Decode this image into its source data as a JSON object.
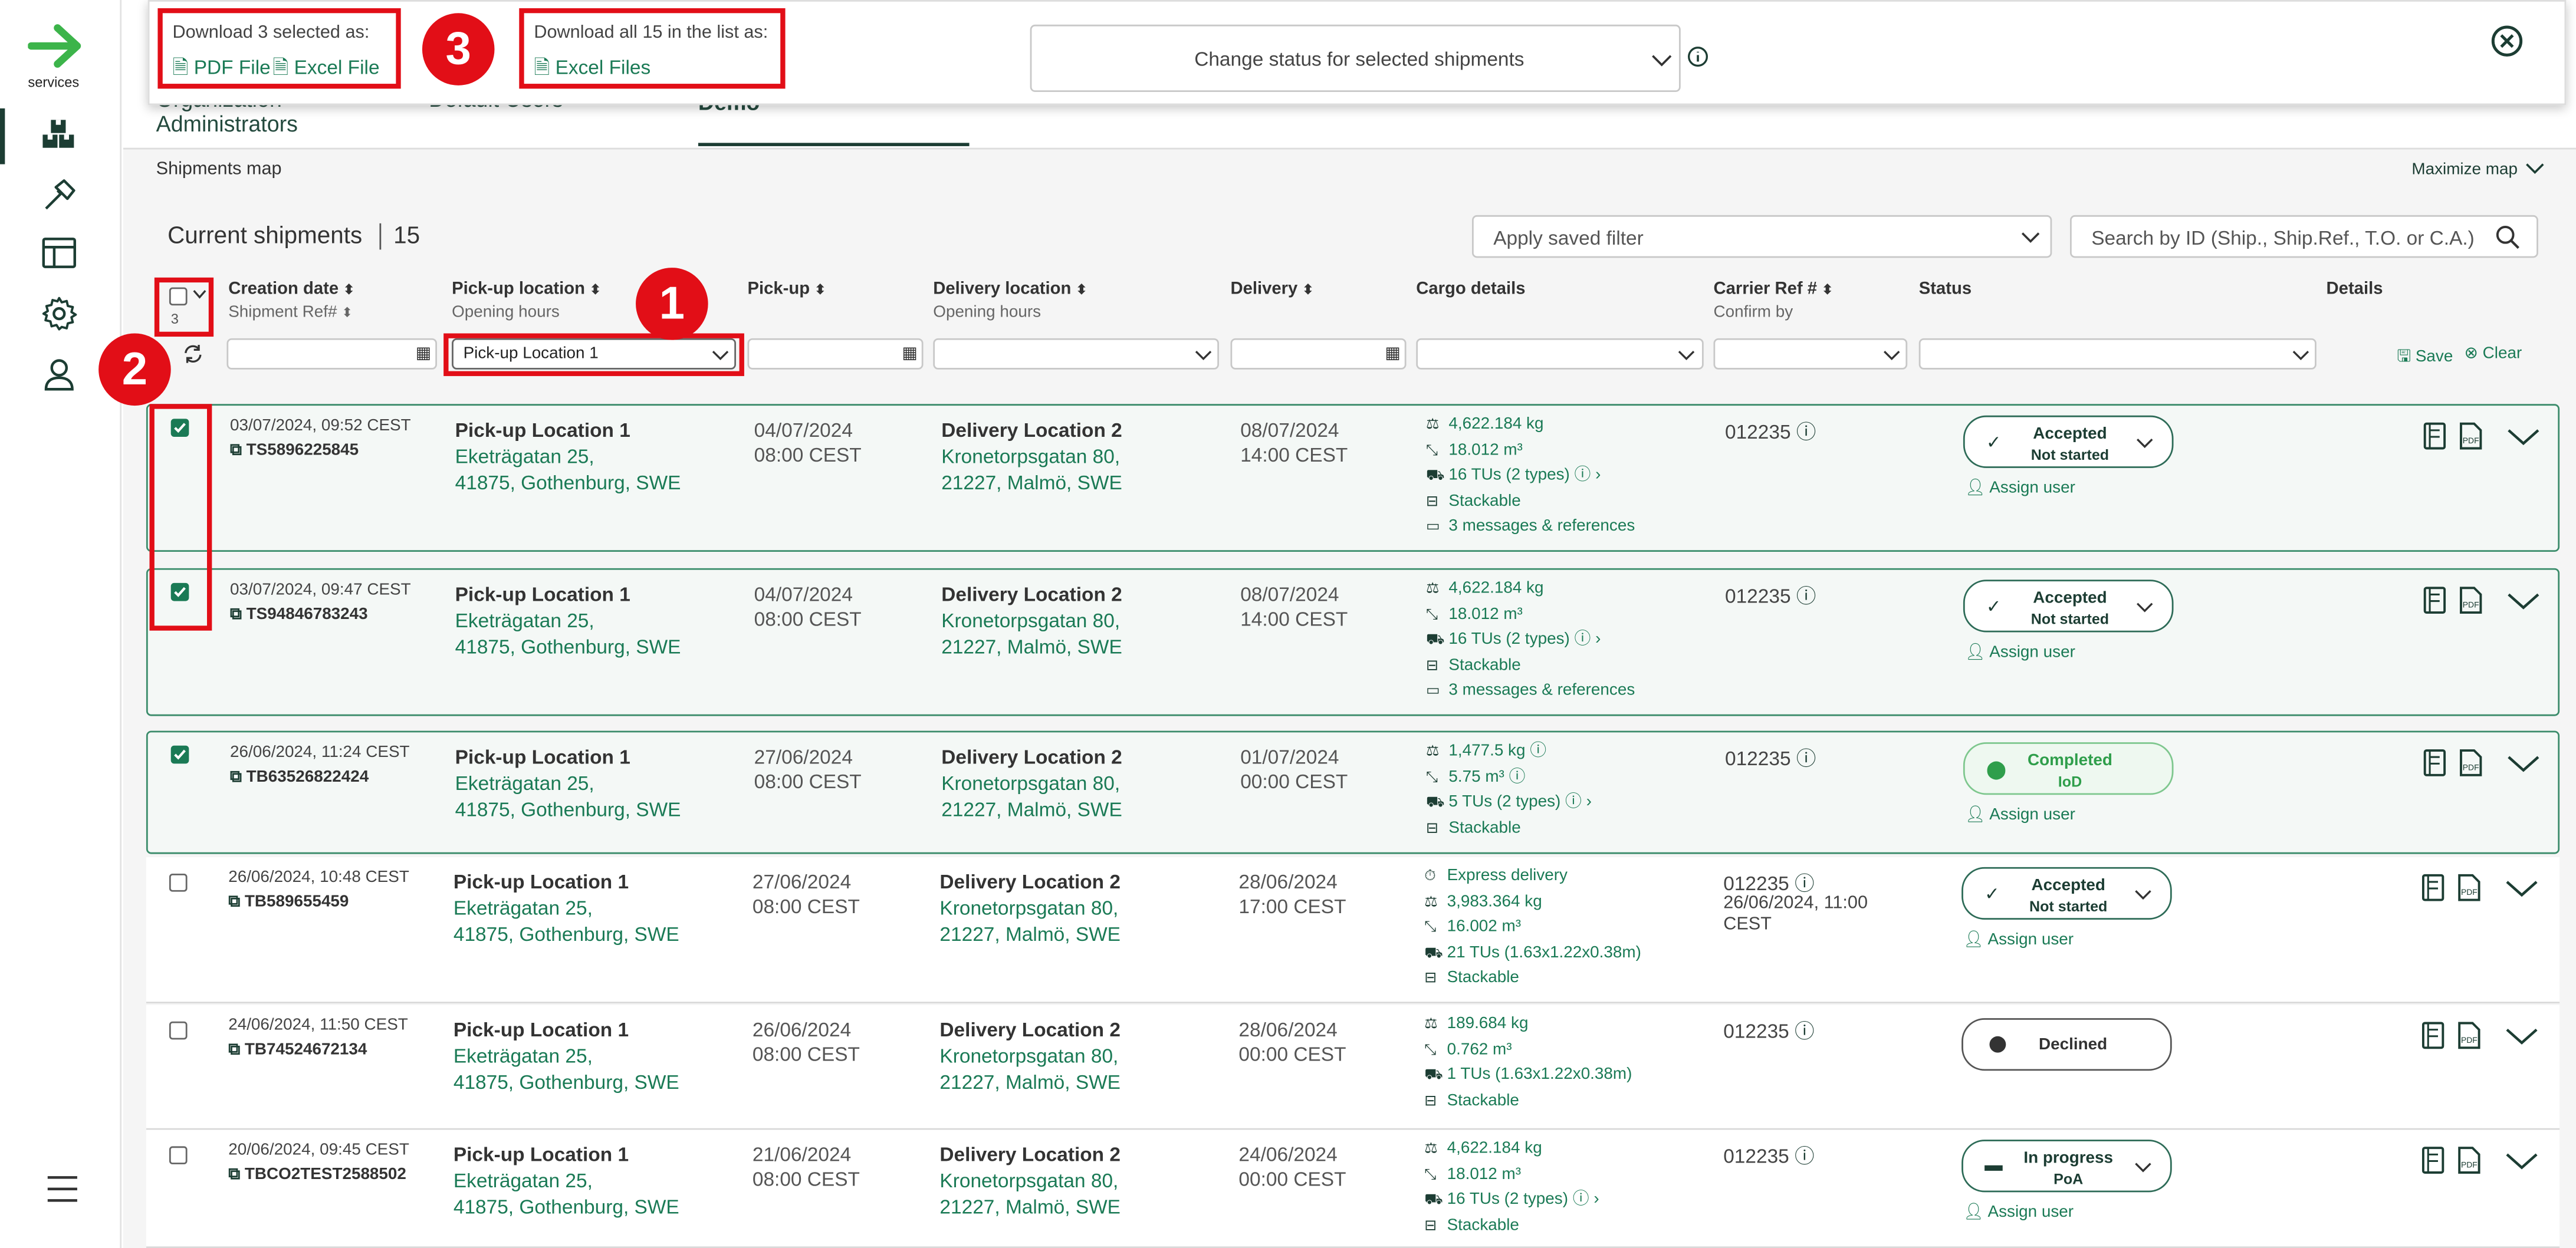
{
  "sidebar": {
    "brand": "services"
  },
  "tabs": {
    "t1a": "Organization",
    "t1b": "Administrators",
    "t2": "Default Users",
    "t3": "Demo"
  },
  "download": {
    "selected_title": "Download 3 selected as:",
    "pdf": "PDF File",
    "excel": "Excel File",
    "all_title": "Download all 15 in the list as:",
    "excel_files": "Excel Files",
    "status_placeholder": "Change status for selected shipments"
  },
  "badges": [
    "1",
    "2",
    "3"
  ],
  "map": {
    "label": "Shipments map",
    "maximize": "Maximize map"
  },
  "list": {
    "title": "Current shipments",
    "count": "15",
    "filter_placeholder": "Apply saved filter",
    "search_placeholder": "Search by ID (Ship., Ship.Ref., T.O. or C.A.)"
  },
  "columns": {
    "creation": "Creation date",
    "ship_ref": "Shipment Ref#",
    "pickup_loc": "Pick-up location",
    "opening": "Opening hours",
    "pickup": "Pick-up",
    "delivery_loc": "Delivery location",
    "opening2": "Opening hours",
    "delivery": "Delivery",
    "cargo": "Cargo details",
    "carrier": "Carrier Ref #",
    "confirm": "Confirm by",
    "status": "Status",
    "details": "Details",
    "selected_count": "3"
  },
  "filters": {
    "pickup_loc_value": "Pick-up Location 1",
    "save": "Save",
    "clear": "Clear"
  },
  "rows": [
    {
      "created": "03/07/2024, 09:52 CEST",
      "ref": "TS5896225845",
      "pu_name": "Pick-up Location 1",
      "pu_addr1": "Eketrägatan 25,",
      "pu_addr2": "41875, Gothenburg, SWE",
      "pu_date": "04/07/2024",
      "pu_time": "08:00 CEST",
      "del_name": "Delivery Location 2",
      "del_addr1": "Kronetorpsgatan 80,",
      "del_addr2": "21227, Malmö, SWE",
      "del_date": "08/07/2024",
      "del_time": "14:00 CEST",
      "c1": "4,622.184 kg",
      "c2": "18.012 m³",
      "c3": "16 TUs (2 types)",
      "c4": "Stackable",
      "c5": "3 messages & references",
      "carrier": "012235",
      "status1": "Accepted",
      "status2": "Not started",
      "assign": "Assign user"
    },
    {
      "created": "03/07/2024, 09:47 CEST",
      "ref": "TS94846783243",
      "pu_name": "Pick-up Location 1",
      "pu_addr1": "Eketrägatan 25,",
      "pu_addr2": "41875, Gothenburg, SWE",
      "pu_date": "04/07/2024",
      "pu_time": "08:00 CEST",
      "del_name": "Delivery Location 2",
      "del_addr1": "Kronetorpsgatan 80,",
      "del_addr2": "21227, Malmö, SWE",
      "del_date": "08/07/2024",
      "del_time": "14:00 CEST",
      "c1": "4,622.184 kg",
      "c2": "18.012 m³",
      "c3": "16 TUs (2 types)",
      "c4": "Stackable",
      "c5": "3 messages & references",
      "carrier": "012235",
      "status1": "Accepted",
      "status2": "Not started",
      "assign": "Assign user"
    },
    {
      "created": "26/06/2024, 11:24 CEST",
      "ref": "TB63526822424",
      "pu_name": "Pick-up Location 1",
      "pu_addr1": "Eketrägatan 25,",
      "pu_addr2": "41875, Gothenburg, SWE",
      "pu_date": "27/06/2024",
      "pu_time": "08:00 CEST",
      "del_name": "Delivery Location 2",
      "del_addr1": "Kronetorpsgatan 80,",
      "del_addr2": "21227, Malmö, SWE",
      "del_date": "01/07/2024",
      "del_time": "00:00 CEST",
      "c1": "1,477.5 kg",
      "c2": "5.75 m³",
      "c3": "5 TUs (2 types)",
      "c4": "Stackable",
      "carrier": "012235",
      "status1": "Completed",
      "status2": "IoD",
      "assign": "Assign user"
    },
    {
      "created": "26/06/2024, 10:48 CEST",
      "ref": "TB589655459",
      "pu_name": "Pick-up Location 1",
      "pu_addr1": "Eketrägatan 25,",
      "pu_addr2": "41875, Gothenburg, SWE",
      "pu_date": "27/06/2024",
      "pu_time": "08:00 CEST",
      "del_name": "Delivery Location 2",
      "del_addr1": "Kronetorpsgatan 80,",
      "del_addr2": "21227, Malmö, SWE",
      "del_date": "28/06/2024",
      "del_time": "17:00 CEST",
      "c0": "Express delivery",
      "c1": "3,983.364 kg",
      "c2": "16.002 m³",
      "c3": "21 TUs (1.63x1.22x0.38m)",
      "c4": "Stackable",
      "carrier": "012235",
      "confirm1": "26/06/2024, 11:00",
      "confirm2": "CEST",
      "status1": "Accepted",
      "status2": "Not started",
      "assign": "Assign user"
    },
    {
      "created": "24/06/2024, 11:50 CEST",
      "ref": "TB74524672134",
      "pu_name": "Pick-up Location 1",
      "pu_addr1": "Eketrägatan 25,",
      "pu_addr2": "41875, Gothenburg, SWE",
      "pu_date": "26/06/2024",
      "pu_time": "08:00 CEST",
      "del_name": "Delivery Location 2",
      "del_addr1": "Kronetorpsgatan 80,",
      "del_addr2": "21227, Malmö, SWE",
      "del_date": "28/06/2024",
      "del_time": "00:00 CEST",
      "c1": "189.684 kg",
      "c2": "0.762 m³",
      "c3": "1 TUs (1.63x1.22x0.38m)",
      "c4": "Stackable",
      "carrier": "012235",
      "status1": "Declined"
    },
    {
      "created": "20/06/2024, 09:45 CEST",
      "ref": "TBCO2TEST2588502",
      "pu_name": "Pick-up Location 1",
      "pu_addr1": "Eketrägatan 25,",
      "pu_addr2": "41875, Gothenburg, SWE",
      "pu_date": "21/06/2024",
      "pu_time": "08:00 CEST",
      "del_name": "Delivery Location 2",
      "del_addr1": "Kronetorpsgatan 80,",
      "del_addr2": "21227, Malmö, SWE",
      "del_date": "24/06/2024",
      "del_time": "00:00 CEST",
      "c1": "4,622.184 kg",
      "c2": "18.012 m³",
      "c3": "16 TUs (2 types)",
      "c4": "Stackable",
      "carrier": "012235",
      "status1": "In progress",
      "status2": "PoA",
      "assign": "Assign user"
    }
  ],
  "colors": {
    "accent": "#1a7a55",
    "dark": "#1c3d33",
    "highlight": "#e20e17",
    "brand_arrow": "#3cb44a"
  }
}
